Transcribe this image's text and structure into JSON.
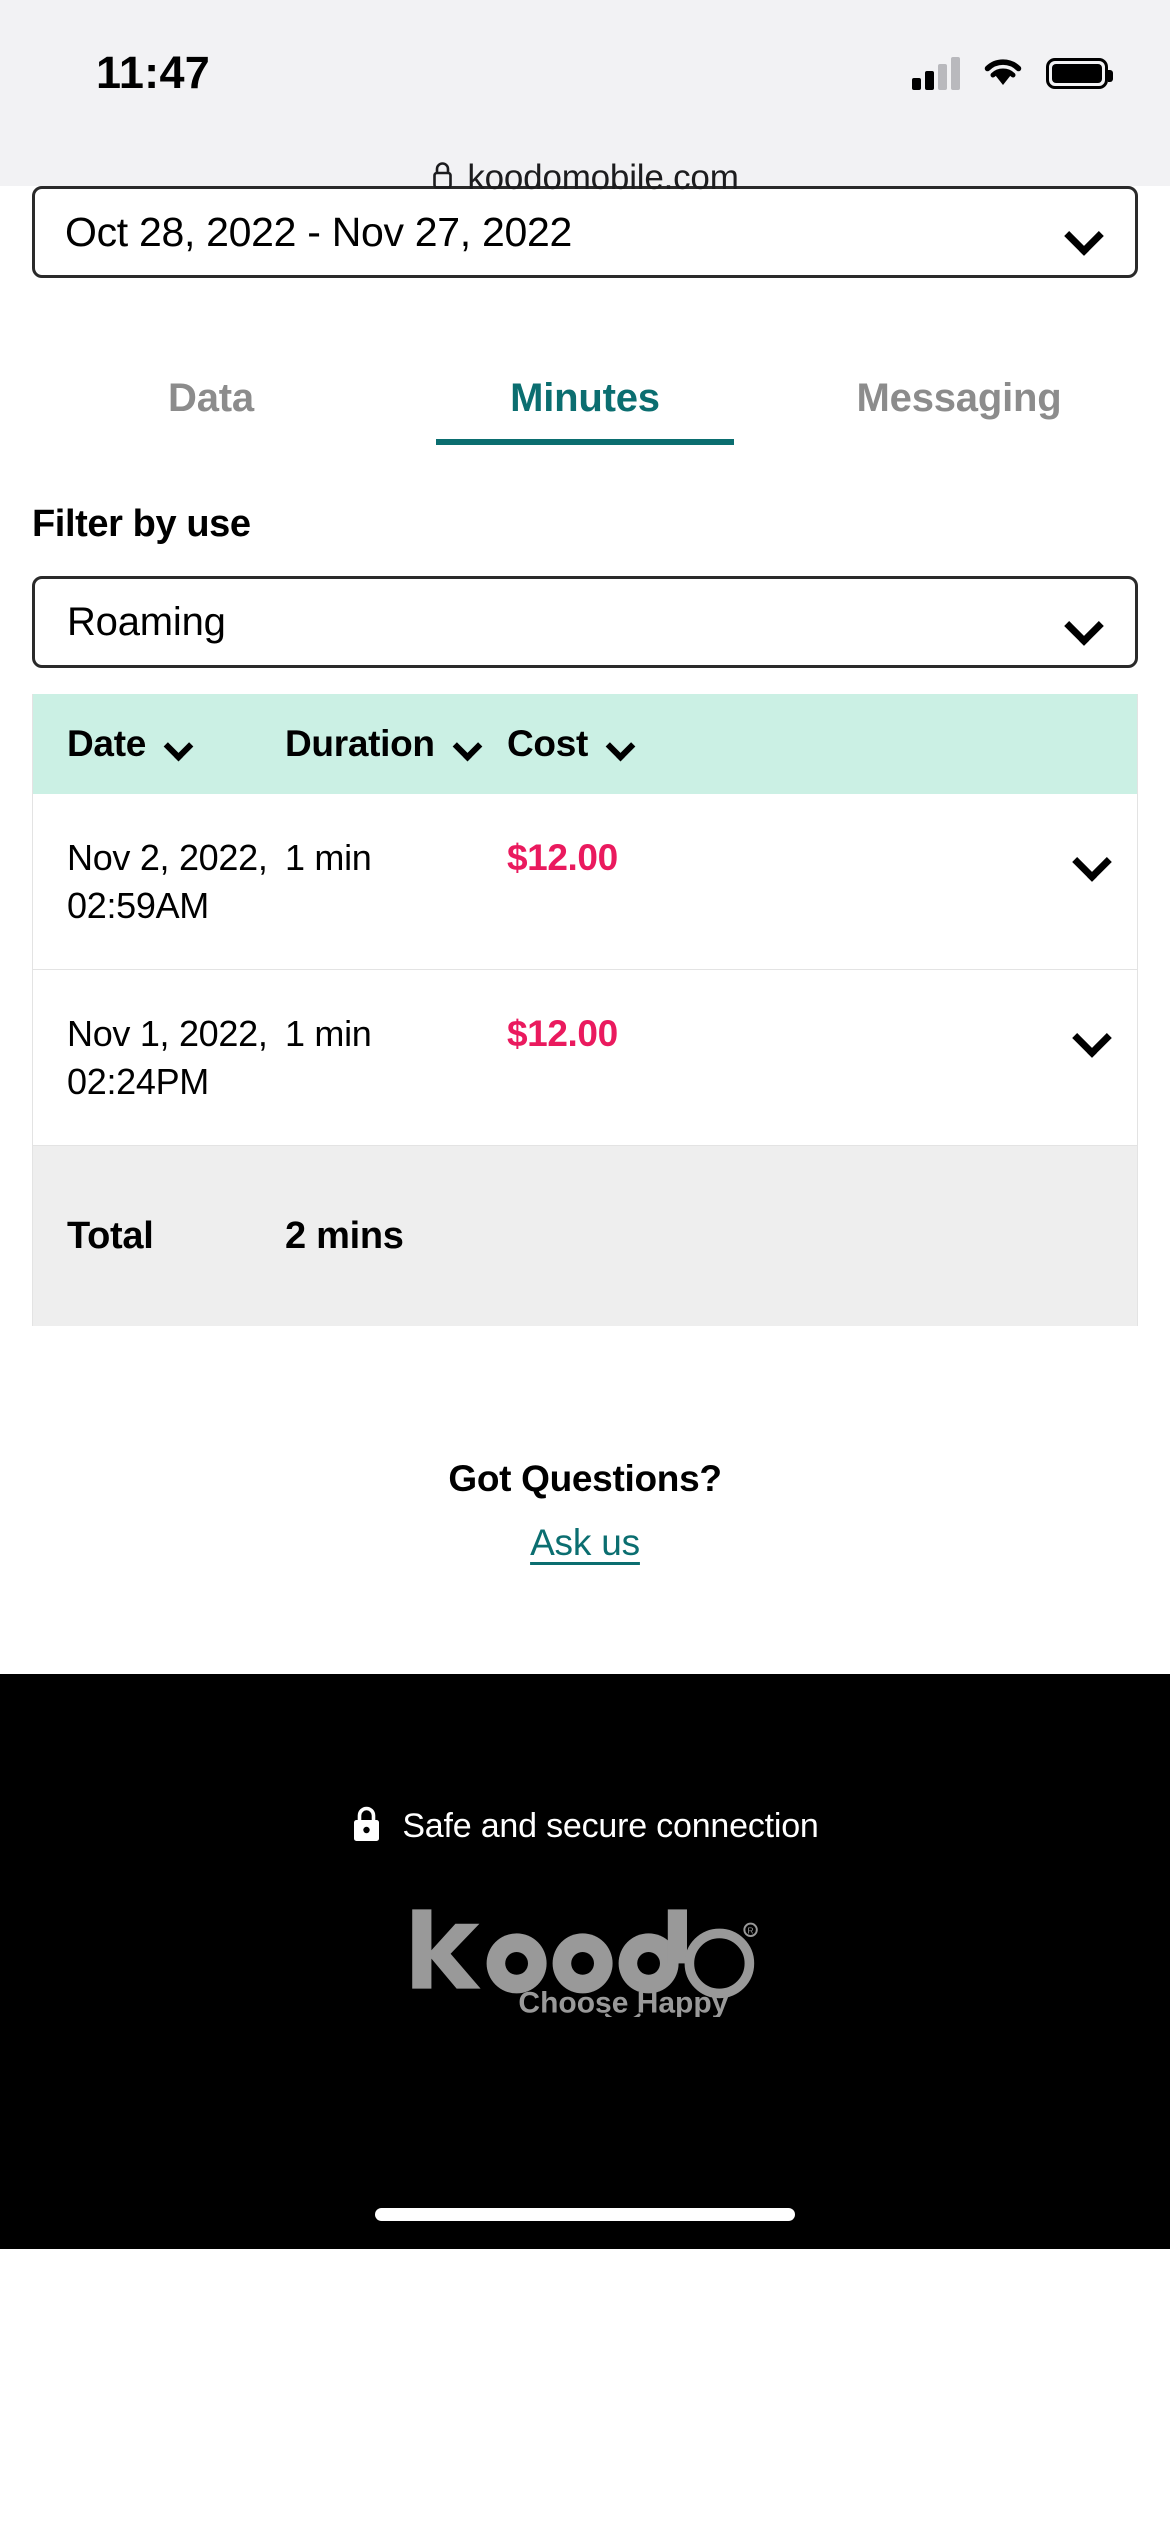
{
  "status_bar": {
    "time": "11:47",
    "signal_icon": "cellular-signal-icon",
    "wifi_icon": "wifi-icon",
    "battery_icon": "battery-full-icon"
  },
  "browser": {
    "lock_icon": "lock-icon",
    "url": "koodomobile.com"
  },
  "date_range": {
    "value": "Oct 28, 2022 - Nov 27, 2022",
    "chevron_icon": "chevron-down-icon"
  },
  "tabs": [
    {
      "label": "Data",
      "active": false
    },
    {
      "label": "Minutes",
      "active": true
    },
    {
      "label": "Messaging",
      "active": false
    }
  ],
  "filter": {
    "label": "Filter by use",
    "value": "Roaming",
    "chevron_icon": "chevron-down-icon"
  },
  "usage_table": {
    "columns": [
      "Date",
      "Duration",
      "Cost"
    ],
    "rows": [
      {
        "date": "Nov 2, 2022, 02:59AM",
        "duration": "1 min",
        "cost": "$12.00",
        "expand_icon": "chevron-down-icon"
      },
      {
        "date": "Nov 1, 2022, 02:24PM",
        "duration": "1 min",
        "cost": "$12.00",
        "expand_icon": "chevron-down-icon"
      }
    ],
    "total_label": "Total",
    "total_duration": "2 mins"
  },
  "help": {
    "title": "Got Questions?",
    "link": "Ask us"
  },
  "footer": {
    "secure_icon": "lock-icon",
    "secure_text": "Safe and secure connection",
    "brand_name": "koodo",
    "tagline": "Choose Happy"
  },
  "colors": {
    "tab_active": "#0b6e70",
    "table_header_bg": "#cbf0e4",
    "price": "#ea1a5e",
    "total_row_bg": "#eeeeee",
    "footer_bg": "#000000",
    "brand_gray": "#999999"
  }
}
